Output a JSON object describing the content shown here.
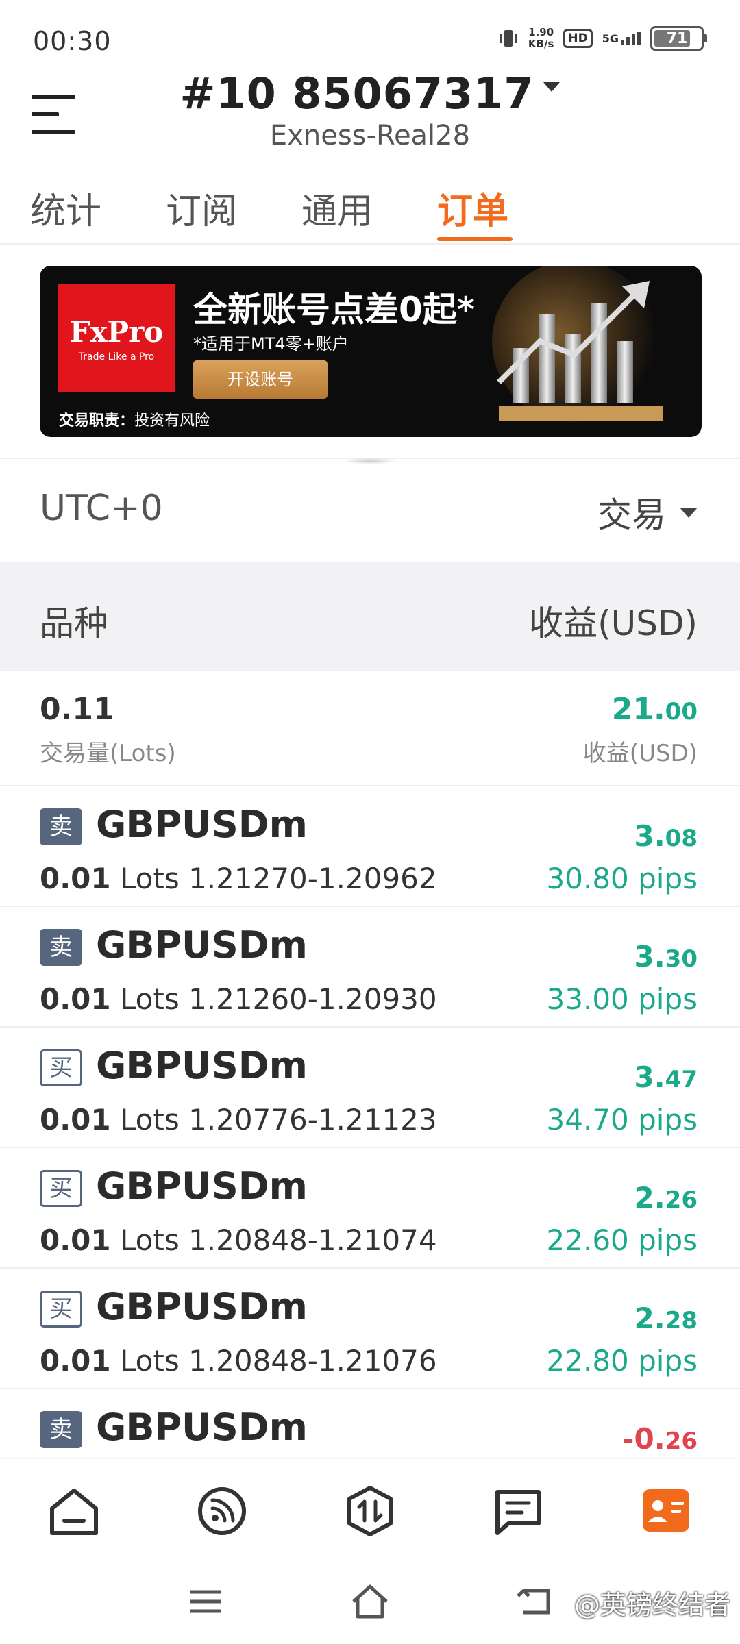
{
  "status_bar": {
    "time": "00:30",
    "net_speed": "1.90",
    "net_unit": "KB/s",
    "hd": "HD",
    "network": "5G",
    "battery": "71"
  },
  "header": {
    "account_number": "#10 85067317",
    "server": "Exness-Real28",
    "icons": [
      "menu-icon",
      "dropdown-caret-icon"
    ]
  },
  "tabs": [
    {
      "label": "统计",
      "active": false
    },
    {
      "label": "订阅",
      "active": false
    },
    {
      "label": "通用",
      "active": false
    },
    {
      "label": "订单",
      "active": true
    }
  ],
  "banner": {
    "brand": "FxPro",
    "brand_tagline": "Trade Like a Pro",
    "title": "全新账号点差0起*",
    "subtitle": "*适用于MT4零+账户",
    "button": "开设账号",
    "risk_label": "交易职责：",
    "risk_text": "投资有风险"
  },
  "filter": {
    "timezone": "UTC+0",
    "type": "交易"
  },
  "table_header": {
    "symbol": "品种",
    "profit": "收益(USD)"
  },
  "summary": {
    "volume": "0.11",
    "volume_label": "交易量(Lots)",
    "profit_int": "21.",
    "profit_dec": "00",
    "profit_label": "收益(USD)"
  },
  "orders": [
    {
      "side": "卖",
      "symbol": "GBPUSDm",
      "lots": "0.01",
      "unit": "Lots",
      "prices": "1.21270-1.20962",
      "pnl_int": "3.",
      "pnl_dec": "08",
      "pips": "30.80 pips"
    },
    {
      "side": "卖",
      "symbol": "GBPUSDm",
      "lots": "0.01",
      "unit": "Lots",
      "prices": "1.21260-1.20930",
      "pnl_int": "3.",
      "pnl_dec": "30",
      "pips": "33.00 pips"
    },
    {
      "side": "买",
      "symbol": "GBPUSDm",
      "lots": "0.01",
      "unit": "Lots",
      "prices": "1.20776-1.21123",
      "pnl_int": "3.",
      "pnl_dec": "47",
      "pips": "34.70 pips"
    },
    {
      "side": "买",
      "symbol": "GBPUSDm",
      "lots": "0.01",
      "unit": "Lots",
      "prices": "1.20848-1.21074",
      "pnl_int": "2.",
      "pnl_dec": "26",
      "pips": "22.60 pips"
    },
    {
      "side": "买",
      "symbol": "GBPUSDm",
      "lots": "0.01",
      "unit": "Lots",
      "prices": "1.20848-1.21076",
      "pnl_int": "2.",
      "pnl_dec": "28",
      "pips": "22.80 pips"
    },
    {
      "side": "卖",
      "symbol": "GBPUSDm",
      "pnl_int": "-0.",
      "pnl_dec": "26"
    }
  ],
  "bottom_nav": [
    "home-icon",
    "signal-feed-icon",
    "trade-icon",
    "messages-icon",
    "profile-card-icon"
  ],
  "watermark": "@英镑终结者",
  "colors": {
    "accent": "#f26a1b",
    "profit": "#1aa98a",
    "loss": "#e0444e",
    "side_badge": "#56667f"
  }
}
